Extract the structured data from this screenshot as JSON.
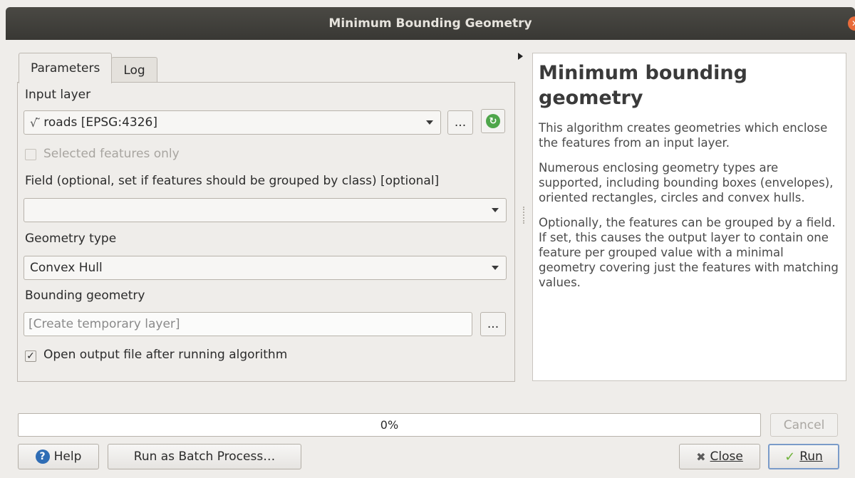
{
  "window": {
    "title": "Minimum Bounding Geometry"
  },
  "tabs": [
    {
      "label": "Parameters"
    },
    {
      "label": "Log"
    }
  ],
  "params": {
    "input_layer_label": "Input layer",
    "input_layer_value": "roads [EPSG:4326]",
    "input_layer_icon": "√ ̃",
    "browse_label": "...",
    "selected_only_label": "Selected features only",
    "field_label": "Field (optional, set if features should be grouped by class) [optional]",
    "field_value": "",
    "geometry_type_label": "Geometry type",
    "geometry_type_value": "Convex Hull",
    "bounding_geometry_label": "Bounding geometry",
    "bounding_geometry_placeholder": "[Create temporary layer]",
    "open_output_label": "Open output file after running algorithm",
    "open_output_checked": true
  },
  "help": {
    "title": "Minimum bounding geometry",
    "paragraphs": [
      "This algorithm creates geometries which enclose the features from an input layer.",
      "Numerous enclosing geometry types are supported, including bounding boxes (envelopes), oriented rectangles, circles and convex hulls.",
      "Optionally, the features can be grouped by a field. If set, this causes the output layer to contain one feature per grouped value with a minimal geometry covering just the features with matching values."
    ]
  },
  "progress": {
    "text": "0%",
    "value": 0
  },
  "buttons": {
    "cancel": "Cancel",
    "help": "Help",
    "batch": "Run as Batch Process…",
    "close": "Close",
    "run": "Run"
  },
  "icons": {
    "help": "help-icon",
    "refresh": "refresh-icon",
    "close": "close-icon",
    "run": "check-icon"
  }
}
